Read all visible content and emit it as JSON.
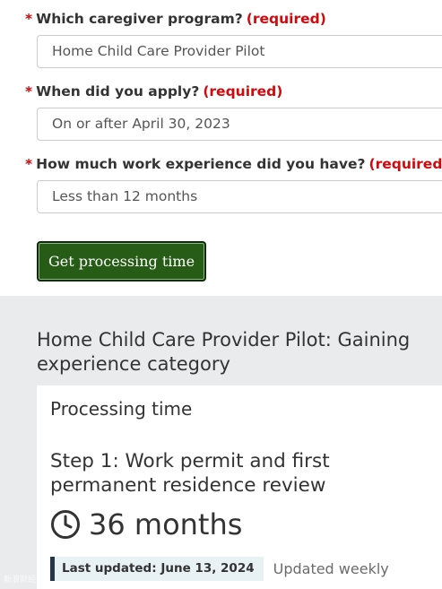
{
  "form": {
    "required_marker": "*",
    "required_text": "(required)",
    "questions": [
      {
        "label": "Which caregiver program?",
        "value": "Home Child Care Provider Pilot"
      },
      {
        "label": "When did you apply?",
        "value": "On or after April 30, 2023"
      },
      {
        "label": "How much work experience did you have?",
        "value": "Less than 12 months"
      }
    ],
    "submit_label": "Get processing time"
  },
  "results": {
    "heading": "Home Child Care Provider Pilot: Gaining experience category",
    "card_title": "Processing time",
    "step_title": "Step 1: Work permit and first permanent residence review",
    "duration": "36 months",
    "duration_icon": "clock-icon",
    "last_updated": "Last updated: June 13, 2024",
    "update_frequency": "Updated weekly"
  },
  "watermark": "新浪财经",
  "colors": {
    "required": "#d3080c",
    "button_bg": "#265c15",
    "results_bg": "#eaebed",
    "updated_bar": "#26374a"
  }
}
